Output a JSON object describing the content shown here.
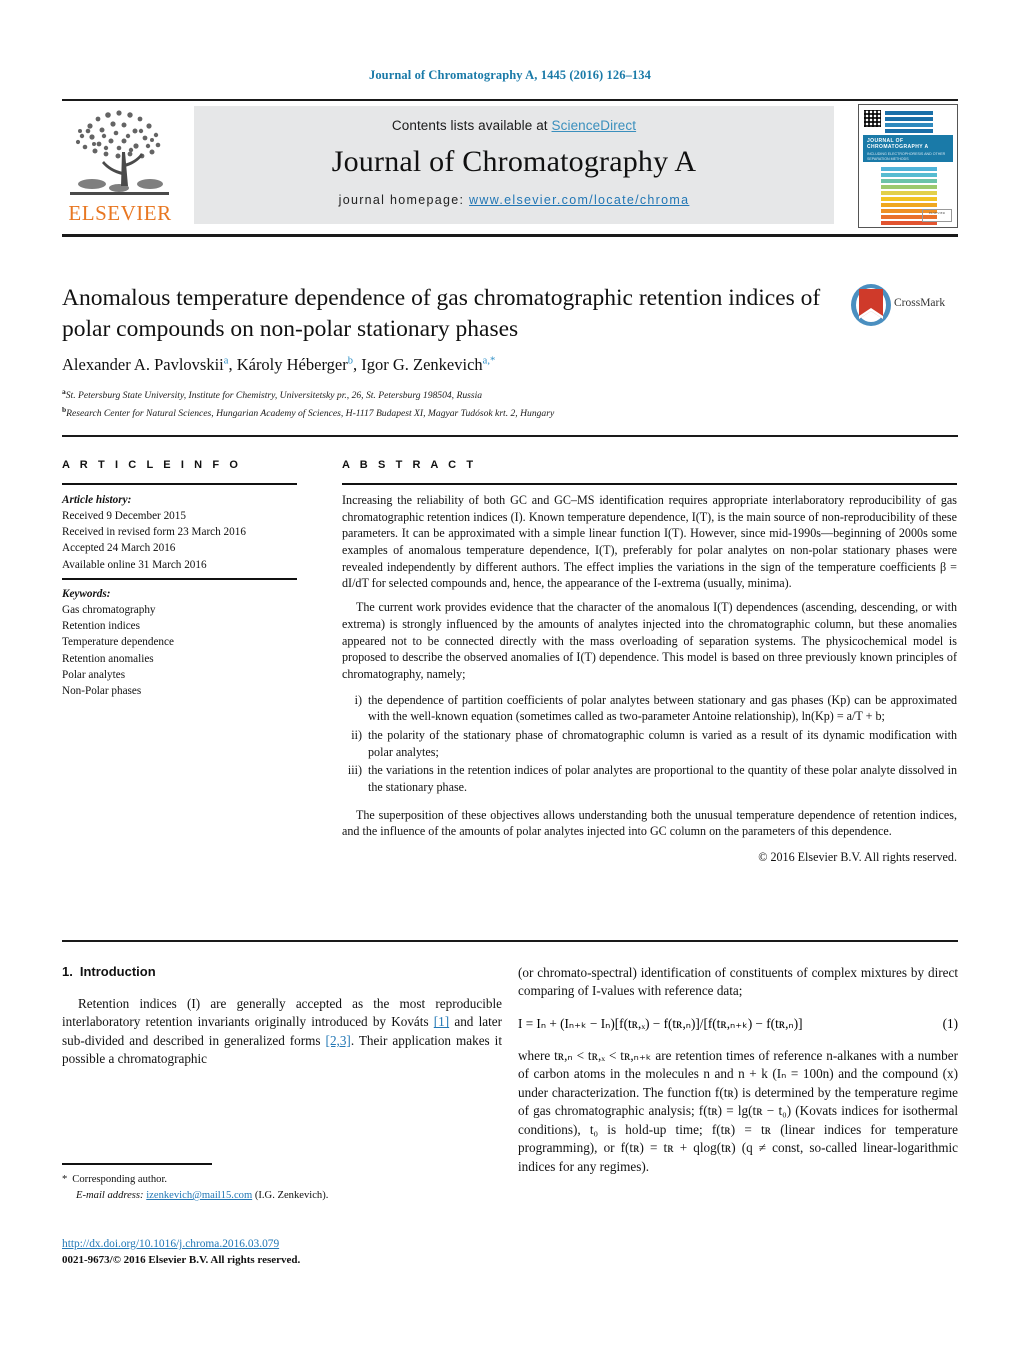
{
  "running_head": "Journal of Chromatography A, 1445 (2016) 126–134",
  "masthead": {
    "contents_prefix": "Contents lists available at ",
    "sciencedirect": "ScienceDirect",
    "journal_title": "Journal of Chromatography A",
    "homepage_prefix": "journal homepage: ",
    "homepage_url": "www.elsevier.com/locate/chroma",
    "publisher": "ELSEVIER",
    "cover_band_title": "JOURNAL OF CHROMATOGRAPHY A",
    "cover_band_sub": "INCLUDING ELECTROPHORESIS AND OTHER SEPARATION METHODS"
  },
  "crossmark": {
    "label": "CrossMark"
  },
  "article": {
    "title": "Anomalous temperature dependence of gas chromatographic retention indices of polar compounds on non-polar stationary phases",
    "authors_html": "Alexander A. Pavlovskii<sup>a</sup>, Károly Héberger<sup>b</sup>, Igor G. Zenkevich<sup>a,*</sup>",
    "affiliations": [
      {
        "marker": "a",
        "text": "St. Petersburg State University, Institute for Chemistry, Universitetsky pr., 26, St. Petersburg 198504, Russia"
      },
      {
        "marker": "b",
        "text": "Research Center for Natural Sciences, Hungarian Academy of Sciences, H-1117 Budapest XI, Magyar Tudósok krt. 2, Hungary"
      }
    ]
  },
  "info": {
    "heading": "A R T I C L E    I N F O",
    "history_label": "Article history:",
    "history": [
      "Received 9 December 2015",
      "Received in revised form 23 March 2016",
      "Accepted 24 March 2016",
      "Available online 31 March 2016"
    ],
    "keywords_label": "Keywords:",
    "keywords": [
      "Gas chromatography",
      "Retention indices",
      "Temperature dependence",
      "Retention anomalies",
      "Polar analytes",
      "Non-Polar phases"
    ]
  },
  "abstract": {
    "heading": "A B S T R A C T",
    "p1": "Increasing the reliability of both GC and GC–MS identification requires appropriate interlaboratory reproducibility of gas chromatographic retention indices (I). Known temperature dependence, I(T), is the main source of non-reproducibility of these parameters. It can be approximated with a simple linear function I(T). However, since mid-1990s—beginning of 2000s some examples of anomalous temperature dependence, I(T), preferably for polar analytes on non-polar stationary phases were revealed independently by different authors. The effect implies the variations in the sign of the temperature coefficients β = dI/dT for selected compounds and, hence, the appearance of the I-extrema (usually, minima).",
    "p2": "The current work provides evidence that the character of the anomalous I(T) dependences (ascending, descending, or with extrema) is strongly influenced by the amounts of analytes injected into the chromatographic column, but these anomalies appeared not to be connected directly with the mass overloading of separation systems. The physicochemical model is proposed to describe the observed anomalies of I(T) dependence. This model is based on three previously known principles of chromatography, namely;",
    "list": [
      {
        "marker": "i)",
        "text": "the dependence of partition coefficients of polar analytes between stationary and gas phases (Kp) can be approximated with the well-known equation (sometimes called as two-parameter Antoine relationship), ln(Kp) = a/T + b;"
      },
      {
        "marker": "ii)",
        "text": "the polarity of the stationary phase of chromatographic column is varied as a result of its dynamic modification with polar analytes;"
      },
      {
        "marker": "iii)",
        "text": "the variations in the retention indices of polar analytes are proportional to the quantity of these polar analyte dissolved in the stationary phase."
      }
    ],
    "p3": "The superposition of these objectives allows understanding both the unusual temperature dependence of retention indices, and the influence of the amounts of polar analytes injected into GC column on the parameters of this dependence.",
    "copyright": "© 2016 Elsevier B.V. All rights reserved."
  },
  "body": {
    "section_number": "1.",
    "section_title": "Introduction",
    "left_p1_a": "Retention indices (I) are generally accepted as the most reproducible interlaboratory retention invariants originally introduced by Kováts ",
    "left_ref1": "[1]",
    "left_p1_b": " and later sub-divided and described in generalized forms ",
    "left_ref2": "[2,3]",
    "left_p1_c": ". Their application makes it possible a chromatographic",
    "right_p1": "(or chromato-spectral) identification of constituents of complex mixtures by direct comparing of I-values with reference data;",
    "equation_text": "I = Iₙ + (Iₙ₊ₖ − Iₙ)[f(tʀ,ₓ) − f(tʀ,ₙ)]/[f(tʀ,ₙ₊ₖ) − f(tʀ,ₙ)]",
    "equation_number": "(1)",
    "right_p2": "where tʀ,ₙ < tʀ,ₓ < tʀ,ₙ₊ₖ are retention times of reference n-alkanes with a number of carbon atoms in the molecules n and n + k (Iₙ = 100n) and the compound (x) under characterization. The function f(tʀ) is determined by the temperature regime of gas chromatographic analysis; f(tʀ) = lg(tʀ − t₀) (Kovats indices for isothermal conditions), t₀ is hold-up time; f(tʀ) = tʀ (linear indices for temperature programming), or f(tʀ) = tʀ + qlog(tʀ) (q ≠ const, so-called linear-logarithmic indices for any regimes)."
  },
  "footer": {
    "corresponding": "Corresponding author.",
    "email_label": "E-mail address:",
    "email": "izenkevich@mail15.com",
    "email_owner": "(I.G. Zenkevich).",
    "doi": "http://dx.doi.org/10.1016/j.chroma.2016.03.079",
    "issn_line": "0021-9673/© 2016 Elsevier B.V. All rights reserved."
  },
  "colors": {
    "link": "#2277b5",
    "elsevier_orange": "#e87722",
    "cover_blue": "#1a7aa8"
  }
}
